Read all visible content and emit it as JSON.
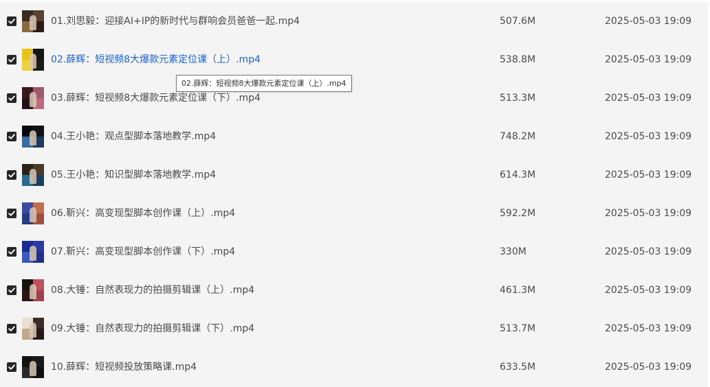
{
  "colors": {
    "background": "#f4f4f4",
    "text": "#4a4a4a",
    "active_link": "#1e62d6",
    "checkbox": "#262626"
  },
  "files": [
    {
      "name": "01.刘思毅：迎接AI+IP的新时代与群响会员爸爸一起.mp4",
      "size": "507.6M",
      "date": "2025-05-03 19:09",
      "checked": true,
      "thumb_icon": "video-thumbnail-icon",
      "thumb_colors": [
        "#3a2a20",
        "#5a4030",
        "#8a6a40",
        "#2a1c14"
      ]
    },
    {
      "name": "02.薛辉：短视频8大爆款元素定位课（上）.mp4",
      "size": "538.8M",
      "date": "2025-05-03 19:09",
      "checked": true,
      "active": true,
      "thumb_icon": "video-thumbnail-icon",
      "thumb_colors": [
        "#e8c21a",
        "#141414",
        "#f0d040",
        "#1a1a1a"
      ]
    },
    {
      "name": "03.薛辉：短视频8大爆款元素定位课（下）.mp4",
      "size": "513.3M",
      "date": "2025-05-03 19:09",
      "checked": true,
      "thumb_icon": "video-thumbnail-icon",
      "thumb_colors": [
        "#3a1820",
        "#a05a70",
        "#241018",
        "#c06a80"
      ]
    },
    {
      "name": "04.王小艳：观点型脚本落地教学.mp4",
      "size": "748.2M",
      "date": "2025-05-03 19:09",
      "checked": true,
      "thumb_icon": "video-thumbnail-icon",
      "thumb_colors": [
        "#0a0a0e",
        "#121218",
        "#3a6aa0",
        "#1a3a60"
      ]
    },
    {
      "name": "05.王小艳：知识型脚本落地教学.mp4",
      "size": "614.3M",
      "date": "2025-05-03 19:09",
      "checked": true,
      "thumb_icon": "video-thumbnail-icon",
      "thumb_colors": [
        "#2a2418",
        "#4a3a28",
        "#2a6a90",
        "#184060"
      ]
    },
    {
      "name": "06.靳兴：高变现型脚本创作课（上）.mp4",
      "size": "592.2M",
      "date": "2025-05-03 19:09",
      "checked": true,
      "thumb_icon": "video-thumbnail-icon",
      "thumb_colors": [
        "#3a4aa0",
        "#c07050",
        "#2a3a80",
        "#a05040"
      ]
    },
    {
      "name": "07.靳兴：高变现型脚本创作课（下）.mp4",
      "size": "330M",
      "date": "2025-05-03 19:09",
      "checked": true,
      "thumb_icon": "video-thumbnail-icon",
      "thumb_colors": [
        "#1a2a90",
        "#2a3aa0",
        "#3a5ab8",
        "#20308a"
      ]
    },
    {
      "name": "08.大锤：自然表现力的拍摄剪辑课（上）.mp4",
      "size": "461.3M",
      "date": "2025-05-03 19:09",
      "checked": true,
      "thumb_icon": "video-thumbnail-icon",
      "thumb_colors": [
        "#1a1010",
        "#c05060",
        "#2a1414",
        "#a04050"
      ]
    },
    {
      "name": "09.大锤：自然表现力的拍摄剪辑课（下）.mp4",
      "size": "513.7M",
      "date": "2025-05-03 19:09",
      "checked": true,
      "thumb_icon": "video-thumbnail-icon",
      "thumb_colors": [
        "#e8e0d0",
        "#3a2a28",
        "#c0a890",
        "#241818"
      ]
    },
    {
      "name": "10.薛辉：短视频投放策略课.mp4",
      "size": "633.5M",
      "date": "2025-05-03 19:09",
      "checked": true,
      "thumb_icon": "video-thumbnail-icon",
      "thumb_colors": [
        "#121212",
        "#1a1a1a",
        "#2a2a2a",
        "#101010"
      ]
    }
  ],
  "tooltip": {
    "text": "02.薛辉：短视频8大爆款元素定位课（上）.mp4"
  }
}
